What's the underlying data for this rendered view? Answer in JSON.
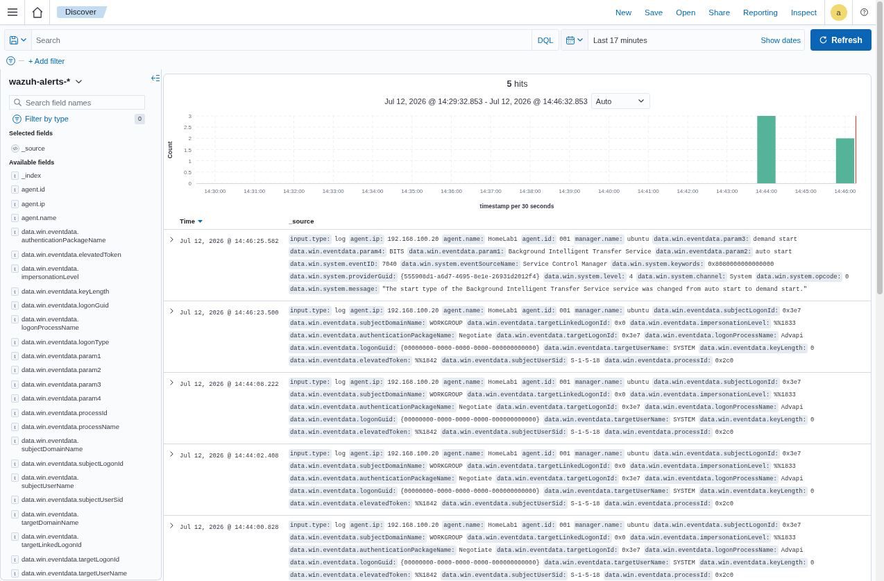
{
  "header": {
    "breadcrumb": "Discover",
    "links": [
      "New",
      "Save",
      "Open",
      "Share",
      "Reporting",
      "Inspect"
    ],
    "avatar": "a"
  },
  "query_bar": {
    "search": {
      "placeholder": "Search"
    },
    "language": "DQL",
    "date_range": "Last 17 minutes",
    "show_dates": "Show dates",
    "refresh": "Refresh"
  },
  "filter_bar": {
    "add_filter": "+ Add filter"
  },
  "sidebar": {
    "index_pattern": "wazuh-alerts-*",
    "search": {
      "placeholder": "Search field names"
    },
    "filter_by_type": {
      "label": "Filter by type",
      "count": "0"
    },
    "selected_fields": {
      "title": "Selected fields",
      "fields": [
        {
          "kind": "source",
          "name": "_source"
        }
      ]
    },
    "available_fields": {
      "title": "Available fields",
      "fields": [
        {
          "kind": "string",
          "token": "t",
          "name": "_index"
        },
        {
          "kind": "string",
          "token": "t",
          "name": "agent.id"
        },
        {
          "kind": "string",
          "token": "t",
          "name": "agent.ip"
        },
        {
          "kind": "string",
          "token": "t",
          "name": "agent.name"
        },
        {
          "kind": "string",
          "token": "t",
          "name": "data.win.eventdata.authenticationPackageName"
        },
        {
          "kind": "string",
          "token": "t",
          "name": "data.win.eventdata.elevatedToken"
        },
        {
          "kind": "string",
          "token": "t",
          "name": "data.win.eventdata.impersonationLevel"
        },
        {
          "kind": "string",
          "token": "t",
          "name": "data.win.eventdata.keyLength"
        },
        {
          "kind": "string",
          "token": "t",
          "name": "data.win.eventdata.logonGuid"
        },
        {
          "kind": "string",
          "token": "t",
          "name": "data.win.eventdata.logonProcessName"
        },
        {
          "kind": "string",
          "token": "t",
          "name": "data.win.eventdata.logonType"
        },
        {
          "kind": "string",
          "token": "t",
          "name": "data.win.eventdata.param1"
        },
        {
          "kind": "string",
          "token": "t",
          "name": "data.win.eventdata.param2"
        },
        {
          "kind": "string",
          "token": "t",
          "name": "data.win.eventdata.param3"
        },
        {
          "kind": "string",
          "token": "t",
          "name": "data.win.eventdata.param4"
        },
        {
          "kind": "string",
          "token": "t",
          "name": "data.win.eventdata.processId"
        },
        {
          "kind": "string",
          "token": "t",
          "name": "data.win.eventdata.processName"
        },
        {
          "kind": "string",
          "token": "t",
          "name": "data.win.eventdata.subjectDomainName"
        },
        {
          "kind": "string",
          "token": "t",
          "name": "data.win.eventdata.subjectLogonId"
        },
        {
          "kind": "string",
          "token": "t",
          "name": "data.win.eventdata.subjectUserName"
        },
        {
          "kind": "string",
          "token": "t",
          "name": "data.win.eventdata.subjectUserSid"
        },
        {
          "kind": "string",
          "token": "t",
          "name": "data.win.eventdata.targetDomainName"
        },
        {
          "kind": "string",
          "token": "t",
          "name": "data.win.eventdata.targetLinkedLogonId"
        },
        {
          "kind": "string",
          "token": "t",
          "name": "data.win.eventdata.targetLogonId"
        },
        {
          "kind": "string",
          "token": "t",
          "name": "data.win.eventdata.targetUserName"
        }
      ]
    }
  },
  "results": {
    "hits": "**5** hits",
    "time_range": "Jul 12, 2026 @ 14:29:32.853 - Jul 12, 2026 @ 14:46:32.853",
    "interval": "Auto",
    "chart_data": {
      "type": "bar",
      "xlabel": "timestamp per 30 seconds",
      "ylabel": "Count",
      "categories": [
        "14:30:00",
        null,
        "14:31:00",
        null,
        "14:32:00",
        null,
        "14:33:00",
        null,
        "14:34:00",
        null,
        "14:35:00",
        null,
        "14:36:00",
        null,
        "14:37:00",
        null,
        "14:38:00",
        null,
        "14:39:00",
        null,
        "14:40:00",
        null,
        "14:41:00",
        null,
        "14:42:00",
        null,
        "14:43:00",
        null,
        "14:44:00",
        null,
        "14:45:00",
        null,
        "14:46:00"
      ],
      "values": [
        0,
        0,
        0,
        0,
        0,
        0,
        0,
        0,
        0,
        0,
        0,
        0,
        0,
        0,
        0,
        0,
        0,
        0,
        0,
        0,
        0,
        0,
        0,
        0,
        0,
        0,
        0,
        0,
        3,
        0,
        0,
        0,
        2
      ],
      "ylim": [
        0,
        3
      ],
      "yticks": [
        0,
        0.5,
        1,
        1.5,
        2,
        2.5,
        3
      ],
      "grid": true
    },
    "table": {
      "columns": [
        {
          "label": "Time",
          "sorted": true,
          "descending": true
        },
        {
          "label": "_source",
          "sorted": false
        }
      ],
      "rows": [
        {
          "expanded": false,
          "time": "Jul 12, 2026 @ 14:46:25.582",
          "source": [
            {
              "key": "input.type:",
              "value": "log"
            },
            {
              "key": "agent.ip:",
              "value": "192.168.100.20"
            },
            {
              "key": "agent.name:",
              "value": "HomeLab1"
            },
            {
              "key": "agent.id:",
              "value": "001"
            },
            {
              "key": "manager.name:",
              "value": "ubuntu"
            },
            {
              "key": "data.win.eventdata.param3:",
              "value": "demand start"
            },
            {
              "key": "data.win.eventdata.param4:",
              "value": "BITS"
            },
            {
              "key": "data.win.eventdata.param1:",
              "value": "Background Intelligent Transfer Service"
            },
            {
              "key": "data.win.eventdata.param2:",
              "value": "auto start"
            },
            {
              "key": "data.win.system.eventID:",
              "value": "7040"
            },
            {
              "key": "data.win.system.eventSourceName:",
              "value": "Service Control Manager"
            },
            {
              "key": "data.win.system.keywords:",
              "value": "0x8080000000000000"
            },
            {
              "key": "data.win.system.providerGuid:",
              "value": "{555908d1-a6d7-4695-8e1e-26931d2012f4}"
            },
            {
              "key": "data.win.system.level:",
              "value": "4"
            },
            {
              "key": "data.win.system.channel:",
              "value": "System"
            },
            {
              "key": "data.win.system.opcode:",
              "value": "0"
            },
            {
              "key": "data.win.system.message:",
              "value": "\"The start type of the Background Intelligent Transfer Service service was changed from auto start to demand start.\""
            }
          ]
        },
        {
          "expanded": false,
          "time": "Jul 12, 2026 @ 14:46:23.500",
          "source": [
            {
              "key": "input.type:",
              "value": "log"
            },
            {
              "key": "agent.ip:",
              "value": "192.168.100.20"
            },
            {
              "key": "agent.name:",
              "value": "HomeLab1"
            },
            {
              "key": "agent.id:",
              "value": "001"
            },
            {
              "key": "manager.name:",
              "value": "ubuntu"
            },
            {
              "key": "data.win.eventdata.subjectLogonId:",
              "value": "0x3e7"
            },
            {
              "key": "data.win.eventdata.subjectDomainName:",
              "value": "WORKGROUP"
            },
            {
              "key": "data.win.eventdata.targetLinkedLogonId:",
              "value": "0x0"
            },
            {
              "key": "data.win.eventdata.impersonationLevel:",
              "value": "%%1833"
            },
            {
              "key": "data.win.eventdata.authenticationPackageName:",
              "value": "Negotiate"
            },
            {
              "key": "data.win.eventdata.targetLogonId:",
              "value": "0x3e7"
            },
            {
              "key": "data.win.eventdata.logonProcessName:",
              "value": "Advapi"
            },
            {
              "key": "data.win.eventdata.logonGuid:",
              "value": "{00000000-0000-0000-0000-000000000000}"
            },
            {
              "key": "data.win.eventdata.targetUserName:",
              "value": "SYSTEM"
            },
            {
              "key": "data.win.eventdata.keyLength:",
              "value": "0"
            },
            {
              "key": "data.win.eventdata.elevatedToken:",
              "value": "%%1842"
            },
            {
              "key": "data.win.eventdata.subjectUserSid:",
              "value": "S-1-5-18"
            },
            {
              "key": "data.win.eventdata.processId:",
              "value": "0x2c0"
            }
          ]
        },
        {
          "expanded": false,
          "time": "Jul 12, 2026 @ 14:44:08.222",
          "source": [
            {
              "key": "input.type:",
              "value": "log"
            },
            {
              "key": "agent.ip:",
              "value": "192.168.100.20"
            },
            {
              "key": "agent.name:",
              "value": "HomeLab1"
            },
            {
              "key": "agent.id:",
              "value": "001"
            },
            {
              "key": "manager.name:",
              "value": "ubuntu"
            },
            {
              "key": "data.win.eventdata.subjectLogonId:",
              "value": "0x3e7"
            },
            {
              "key": "data.win.eventdata.subjectDomainName:",
              "value": "WORKGROUP"
            },
            {
              "key": "data.win.eventdata.targetLinkedLogonId:",
              "value": "0x0"
            },
            {
              "key": "data.win.eventdata.impersonationLevel:",
              "value": "%%1833"
            },
            {
              "key": "data.win.eventdata.authenticationPackageName:",
              "value": "Negotiate"
            },
            {
              "key": "data.win.eventdata.targetLogonId:",
              "value": "0x3e7"
            },
            {
              "key": "data.win.eventdata.logonProcessName:",
              "value": "Advapi"
            },
            {
              "key": "data.win.eventdata.logonGuid:",
              "value": "{00000000-0000-0000-0000-000000000000}"
            },
            {
              "key": "data.win.eventdata.targetUserName:",
              "value": "SYSTEM"
            },
            {
              "key": "data.win.eventdata.keyLength:",
              "value": "0"
            },
            {
              "key": "data.win.eventdata.elevatedToken:",
              "value": "%%1842"
            },
            {
              "key": "data.win.eventdata.subjectUserSid:",
              "value": "S-1-5-18"
            },
            {
              "key": "data.win.eventdata.processId:",
              "value": "0x2c0"
            }
          ]
        },
        {
          "expanded": false,
          "time": "Jul 12, 2026 @ 14:44:02.408",
          "source": [
            {
              "key": "input.type:",
              "value": "log"
            },
            {
              "key": "agent.ip:",
              "value": "192.168.100.20"
            },
            {
              "key": "agent.name:",
              "value": "HomeLab1"
            },
            {
              "key": "agent.id:",
              "value": "001"
            },
            {
              "key": "manager.name:",
              "value": "ubuntu"
            },
            {
              "key": "data.win.eventdata.subjectLogonId:",
              "value": "0x3e7"
            },
            {
              "key": "data.win.eventdata.subjectDomainName:",
              "value": "WORKGROUP"
            },
            {
              "key": "data.win.eventdata.targetLinkedLogonId:",
              "value": "0x0"
            },
            {
              "key": "data.win.eventdata.impersonationLevel:",
              "value": "%%1833"
            },
            {
              "key": "data.win.eventdata.authenticationPackageName:",
              "value": "Negotiate"
            },
            {
              "key": "data.win.eventdata.targetLogonId:",
              "value": "0x3e7"
            },
            {
              "key": "data.win.eventdata.logonProcessName:",
              "value": "Advapi"
            },
            {
              "key": "data.win.eventdata.logonGuid:",
              "value": "{00000000-0000-0000-0000-000000000000}"
            },
            {
              "key": "data.win.eventdata.targetUserName:",
              "value": "SYSTEM"
            },
            {
              "key": "data.win.eventdata.keyLength:",
              "value": "0"
            },
            {
              "key": "data.win.eventdata.elevatedToken:",
              "value": "%%1842"
            },
            {
              "key": "data.win.eventdata.subjectUserSid:",
              "value": "S-1-5-18"
            },
            {
              "key": "data.win.eventdata.processId:",
              "value": "0x2c0"
            }
          ]
        },
        {
          "expanded": false,
          "time": "Jul 12, 2026 @ 14:44:00.828",
          "source": [
            {
              "key": "input.type:",
              "value": "log"
            },
            {
              "key": "agent.ip:",
              "value": "192.168.100.20"
            },
            {
              "key": "agent.name:",
              "value": "HomeLab1"
            },
            {
              "key": "agent.id:",
              "value": "001"
            },
            {
              "key": "manager.name:",
              "value": "ubuntu"
            },
            {
              "key": "data.win.eventdata.subjectLogonId:",
              "value": "0x3e7"
            },
            {
              "key": "data.win.eventdata.subjectDomainName:",
              "value": "WORKGROUP"
            },
            {
              "key": "data.win.eventdata.targetLinkedLogonId:",
              "value": "0x0"
            },
            {
              "key": "data.win.eventdata.impersonationLevel:",
              "value": "%%1833"
            },
            {
              "key": "data.win.eventdata.authenticationPackageName:",
              "value": "Negotiate"
            },
            {
              "key": "data.win.eventdata.targetLogonId:",
              "value": "0x3e7"
            },
            {
              "key": "data.win.eventdata.logonProcessName:",
              "value": "Advapi"
            },
            {
              "key": "data.win.eventdata.logonGuid:",
              "value": "{00000000-0000-0000-0000-000000000000}"
            },
            {
              "key": "data.win.eventdata.targetUserName:",
              "value": "SYSTEM"
            },
            {
              "key": "data.win.eventdata.keyLength:",
              "value": "0"
            },
            {
              "key": "data.win.eventdata.elevatedToken:",
              "value": "%%1842"
            },
            {
              "key": "data.win.eventdata.subjectUserSid:",
              "value": "S-1-5-18"
            },
            {
              "key": "data.win.eventdata.processId:",
              "value": "0x2c0"
            }
          ]
        }
      ]
    }
  }
}
